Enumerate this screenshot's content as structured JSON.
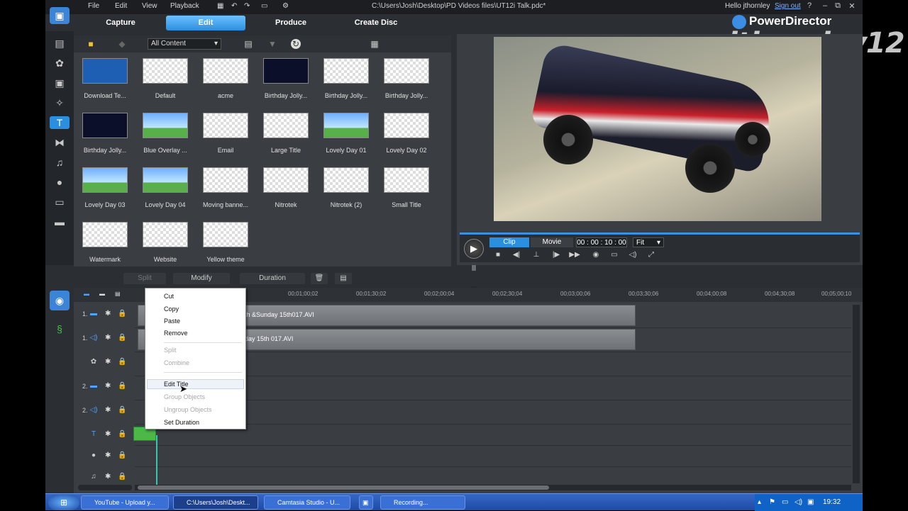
{
  "window": {
    "menu": [
      "File",
      "Edit",
      "View",
      "Playback"
    ],
    "path": "C:\\Users\\Josh\\Desktop\\PD Videos files\\UT12i Talk.pdc*",
    "user": "Hello jthornley",
    "signout": "Sign out",
    "help": "?",
    "minimize": "–",
    "maximize": "⧉",
    "close": "✕"
  },
  "tabs": [
    "Capture",
    "Edit",
    "Produce",
    "Create Disc"
  ],
  "brand": "PowerDirector",
  "watermark": "jthornley12",
  "library": {
    "filter": "All Content",
    "items": [
      {
        "label": "Download Te..."
      },
      {
        "label": "Default"
      },
      {
        "label": "acme"
      },
      {
        "label": "Birthday Jolly..."
      },
      {
        "label": "Birthday Jolly..."
      },
      {
        "label": "Birthday Jolly..."
      },
      {
        "label": "Birthday Jolly..."
      },
      {
        "label": "Blue Overlay ..."
      },
      {
        "label": "Email"
      },
      {
        "label": "Large Title"
      },
      {
        "label": "Lovely Day 01"
      },
      {
        "label": "Lovely Day 02"
      },
      {
        "label": "Lovely Day 03"
      },
      {
        "label": "Lovely Day 04"
      },
      {
        "label": "Moving banne..."
      },
      {
        "label": "Nitrotek"
      },
      {
        "label": "Nitrotek (2)"
      },
      {
        "label": "Small Title"
      },
      {
        "label": "Watermark"
      },
      {
        "label": "Website"
      },
      {
        "label": "Yellow theme"
      }
    ]
  },
  "preview": {
    "mode_clip": "Clip",
    "mode_movie": "Movie",
    "timecode": "00 : 00 : 10 : 00",
    "fit": "Fit"
  },
  "edit_toolbar": {
    "split": "Split",
    "modify": "Modify",
    "duration": "Duration"
  },
  "timeline": {
    "ruler": [
      "00;01;00;02",
      "00;01;30;02",
      "00;02;00;04",
      "00;02;30;04",
      "00;03;00;06",
      "00;03;30;06",
      "00;04;00;08",
      "00;04;30;08",
      "00;05;00;10"
    ],
    "clip_video": "th &Sunday 15th017.AVI",
    "clip_audio": "day 15th 017.AVI"
  },
  "context_menu": {
    "items": [
      {
        "label": "Cut",
        "enabled": true
      },
      {
        "label": "Copy",
        "enabled": true
      },
      {
        "label": "Paste",
        "enabled": true
      },
      {
        "label": "Remove",
        "enabled": true
      },
      {
        "label": "Split",
        "enabled": false
      },
      {
        "label": "Combine",
        "enabled": false
      },
      {
        "label": "Edit Title",
        "enabled": true
      },
      {
        "label": "Group Objects",
        "enabled": false
      },
      {
        "label": "Ungroup Objects",
        "enabled": false
      },
      {
        "label": "Set Duration",
        "enabled": true
      }
    ]
  },
  "taskbar": {
    "tasks": [
      "YouTube - Upload y...",
      "C:\\Users\\Josh\\Deskt...",
      "Camtasia Studio - U...",
      "Recording..."
    ],
    "clock": "19:32"
  },
  "colors": {
    "accent": "#2b8fe0",
    "panel": "#3a3d42",
    "titlebar": "#1c1e21"
  }
}
